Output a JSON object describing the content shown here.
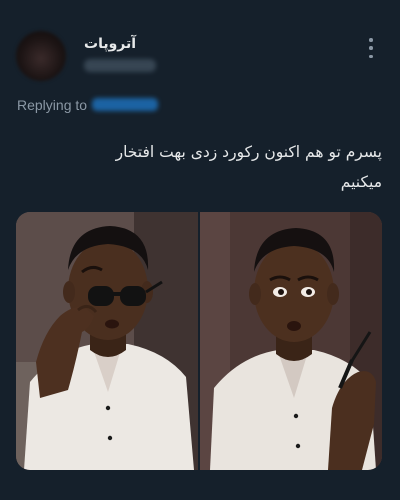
{
  "author": {
    "display_name": "آتروپات"
  },
  "reply": {
    "prefix": "Replying to"
  },
  "tweet": {
    "text_lines": [
      "پسرم تو هم اکنون رکورد زدی بهت افتخار",
      "میکنیم"
    ]
  },
  "media": {
    "count": 2
  },
  "colors": {
    "background": "#15202b",
    "text_primary": "#e7e9ea",
    "text_secondary": "#8b98a5",
    "link": "#1d9bf0"
  },
  "icons": {
    "more": "more-vertical-icon"
  }
}
